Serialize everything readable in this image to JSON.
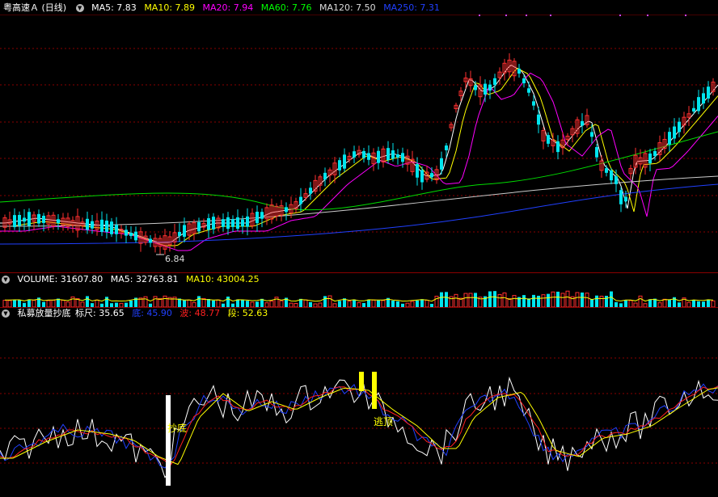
{
  "main_panel": {
    "title": "粤高速Ａ (日线)",
    "indicators": [
      {
        "label": "MA5: 7.83",
        "color": "#ffffff"
      },
      {
        "label": "MA10: 7.89",
        "color": "#ffff00"
      },
      {
        "label": "MA20: 7.94",
        "color": "#ff00ff"
      },
      {
        "label": "MA60: 7.76",
        "color": "#00ff00"
      },
      {
        "label": "MA120: 7.50",
        "color": "#dddddd"
      },
      {
        "label": "MA250: 7.31",
        "color": "#2040ff"
      }
    ],
    "low_label": "6.84"
  },
  "volume_panel": {
    "title": "VOLUME: 31607.80",
    "ma5": "MA5: 32763.81",
    "ma10": "MA10: 43004.25"
  },
  "indicator_panel": {
    "title": "私募放量抄底",
    "ruler": "标尺: 35.65",
    "items": [
      {
        "label": "底: 45.90",
        "color": "#2040ff"
      },
      {
        "label": "波: 48.77",
        "color": "#ff2020"
      },
      {
        "label": "段: 52.63",
        "color": "#ffff00"
      }
    ],
    "signal_bottom": "抄底",
    "signal_top": "逃顶"
  },
  "colors": {
    "up": "#ff3030",
    "down": "#00e5ee",
    "grid": "#8a0000"
  }
}
